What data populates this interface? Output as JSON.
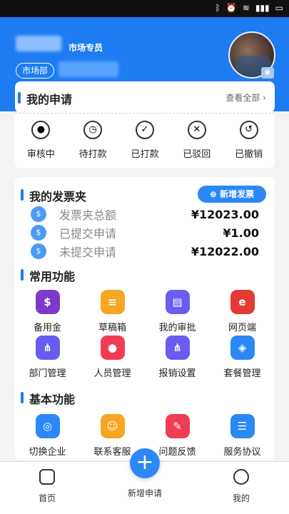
{
  "header": {
    "role": "市场专员",
    "department": "市场部"
  },
  "applications": {
    "title": "我的申请",
    "view_all": "查看全部",
    "statuses": [
      {
        "label": "审核中",
        "icon": "person-icon"
      },
      {
        "label": "待打款",
        "icon": "clock-icon"
      },
      {
        "label": "已打款",
        "icon": "check-icon"
      },
      {
        "label": "已驳回",
        "icon": "x-icon"
      },
      {
        "label": "已撤销",
        "icon": "undo-icon"
      }
    ]
  },
  "invoice": {
    "title": "我的发票夹",
    "new_button": "新增发票",
    "rows": [
      {
        "label": "发票夹总额",
        "value": "¥12023.00"
      },
      {
        "label": "已提交申请",
        "value": "¥1.00"
      },
      {
        "label": "未提交申请",
        "value": "¥12022.00"
      }
    ]
  },
  "common": {
    "title": "常用功能",
    "items": [
      {
        "label": "备用金",
        "icon": "piggy-bank-icon",
        "color": "#7a3cc8"
      },
      {
        "label": "草稿箱",
        "icon": "draft-icon",
        "color": "#f5a623"
      },
      {
        "label": "我的审批",
        "icon": "approval-icon",
        "color": "#6a5cf0"
      },
      {
        "label": "网页端",
        "icon": "ie-icon",
        "color": "#e53935"
      },
      {
        "label": "部门管理",
        "icon": "org-icon",
        "color": "#6a5cf0"
      },
      {
        "label": "人员管理",
        "icon": "person-manage-icon",
        "color": "#ef3e53"
      },
      {
        "label": "报销设置",
        "icon": "settings-tree-icon",
        "color": "#6a5cf0"
      },
      {
        "label": "套餐管理",
        "icon": "layers-icon",
        "color": "#2b88f5"
      }
    ]
  },
  "basic": {
    "title": "基本功能",
    "items": [
      {
        "label": "切换企业",
        "icon": "switch-icon",
        "color": "#2b88f5"
      },
      {
        "label": "联系客服",
        "icon": "service-icon",
        "color": "#f5a623"
      },
      {
        "label": "问题反馈",
        "icon": "feedback-icon",
        "color": "#ef3e53"
      },
      {
        "label": "服务协议",
        "icon": "agreement-icon",
        "color": "#2b88f5"
      }
    ]
  },
  "tabbar": {
    "home": "首页",
    "add": "新增申请",
    "mine": "我的"
  }
}
